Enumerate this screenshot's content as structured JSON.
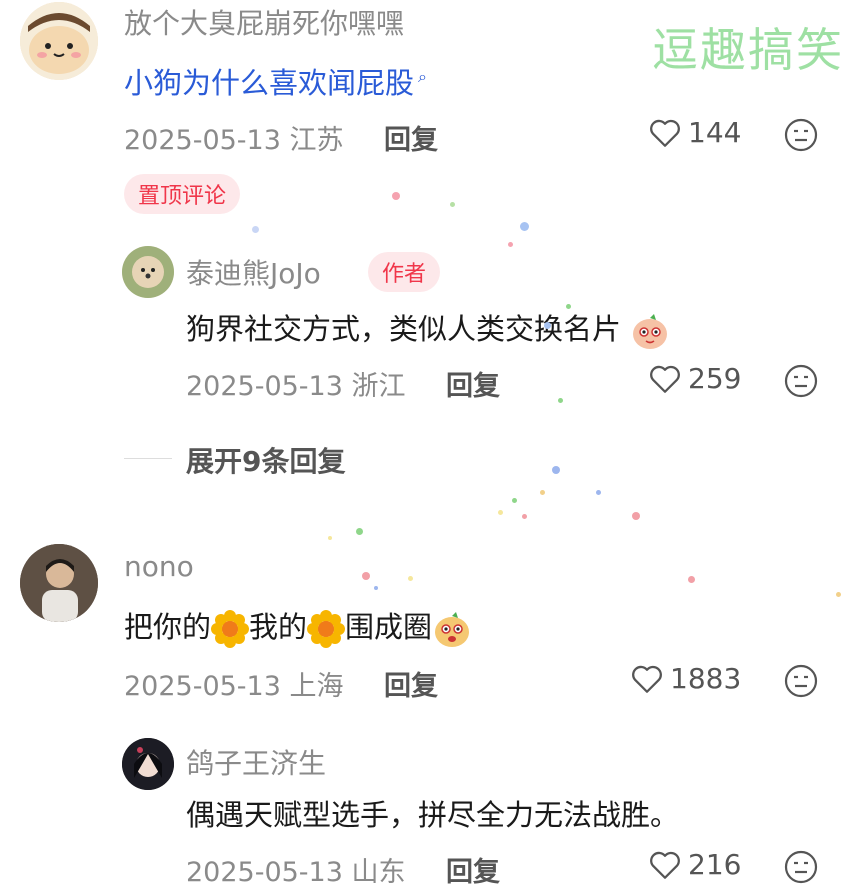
{
  "watermark": "逗趣搞笑",
  "comments": [
    {
      "user": "放个大臭屁崩死你嘿嘿",
      "text": "小狗为什么喜欢闻屁股",
      "search_icon": "search-icon",
      "date_loc": "2025-05-13 江苏",
      "reply": "回复",
      "likes": "144",
      "badge": "置顶评论"
    },
    {
      "user": "泰迪熊JoJo",
      "author_badge": "作者",
      "text": "狗界社交方式，类似人类交换名片",
      "date_loc": "2025-05-13 浙江",
      "reply": "回复",
      "likes": "259"
    },
    {
      "expand": "展开9条回复"
    },
    {
      "user": "nono",
      "text_a": "把你的",
      "text_b": "我的",
      "text_c": "围成圈",
      "date_loc": "2025-05-13 上海",
      "reply": "回复",
      "likes": "1883"
    },
    {
      "user": "鸽子王济生",
      "text": "偶遇天赋型选手，拼尽全力无法战胜。",
      "date_loc": "2025-05-13 山东",
      "reply": "回复",
      "likes": "216"
    }
  ],
  "colors": {
    "accent": "#2a5bd7",
    "badge": "#f0364a",
    "watermark": "#9ee0a3"
  }
}
